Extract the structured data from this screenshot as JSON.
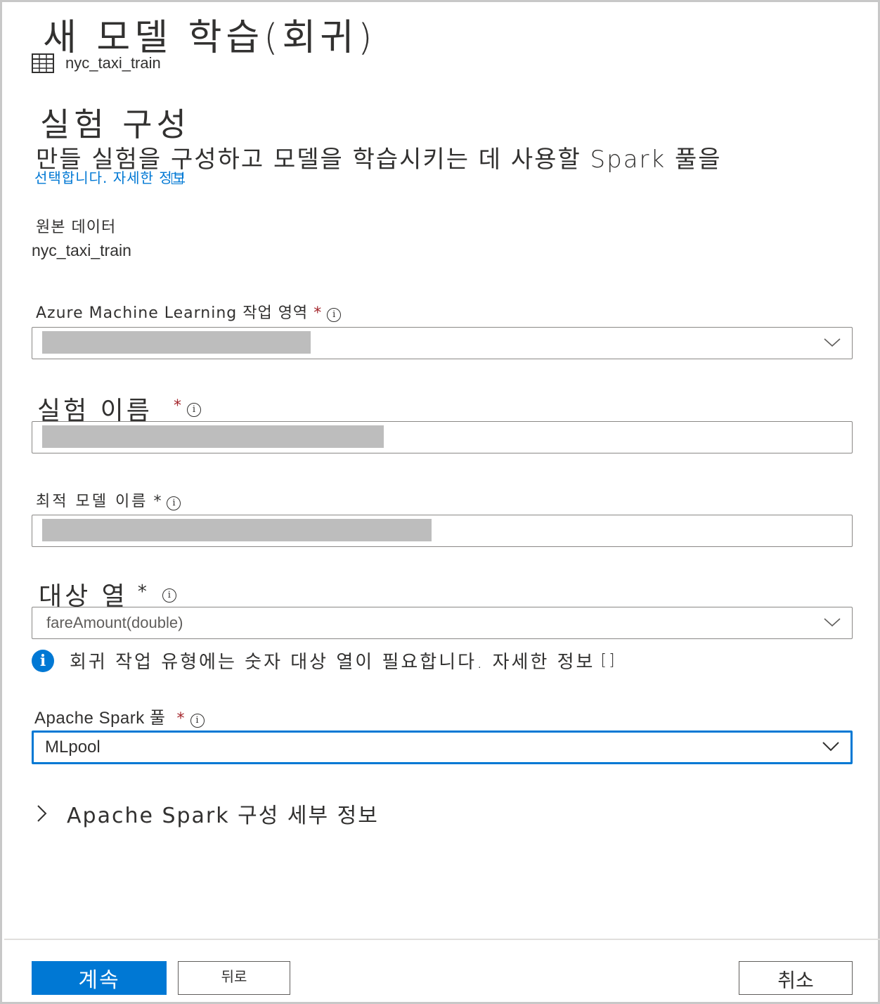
{
  "header": {
    "title": "새 모델 학습(회귀)",
    "dataset_icon": "table-icon",
    "dataset_name": "nyc_taxi_train"
  },
  "section": {
    "title": "실험 구성",
    "description": "만들 실험을 구성하고 모델을 학습시키는 데 사용할 Spark 풀을",
    "description_cont": "선택합니다.",
    "learn_more": "자세한 정보"
  },
  "source_data": {
    "label": "원본 데이터",
    "value": "nyc_taxi_train"
  },
  "workspace": {
    "label": "Azure Machine Learning 작업 영역",
    "required": "*"
  },
  "experiment_name": {
    "label": "실험 이름",
    "required": "*"
  },
  "best_model_name": {
    "label": "최적 모델 이름",
    "required": "*"
  },
  "target_column": {
    "label": "대상 열",
    "required": "*",
    "value": "fareAmount(double)"
  },
  "info_message": {
    "text": "회귀 작업 유형에는 숫자 대상 열이 필요합니다. 자세한 정보",
    "link_suffix": "[]"
  },
  "spark_pool": {
    "label": "Apache Spark 풀",
    "required": "*",
    "value": "MLpool"
  },
  "spark_config": {
    "label": "Apache Spark 구성 세부 정보"
  },
  "footer": {
    "continue_label": "계속",
    "back_label": "뒤로",
    "cancel_label": "취소"
  },
  "colors": {
    "accent": "#0078d4",
    "required": "#a4262c",
    "redaction": "#bdbdbd"
  }
}
